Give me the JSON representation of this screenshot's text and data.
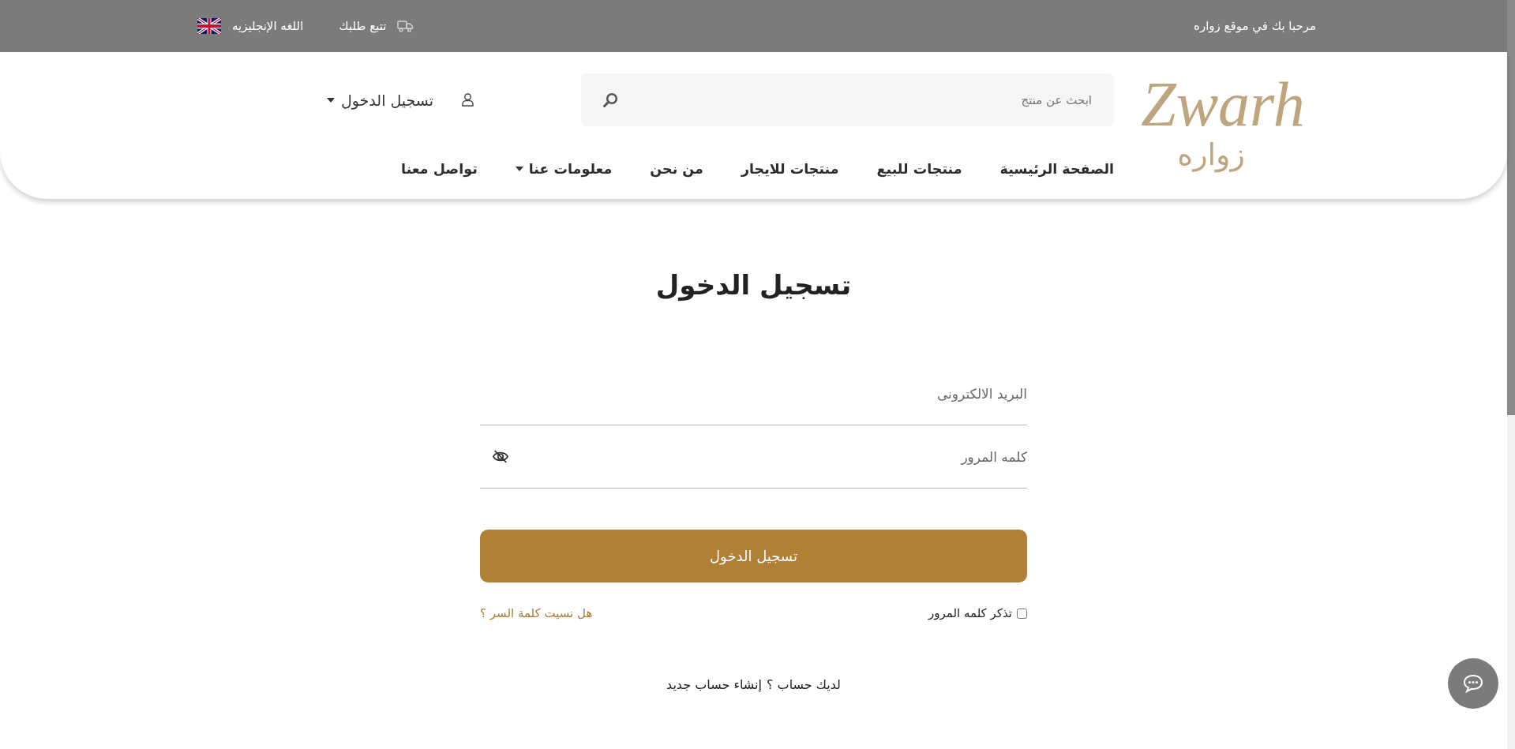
{
  "top_bar": {
    "welcome": "مرحبا بك في موقع زواره",
    "track_order": "تتبع طلبك",
    "language": "اللغه الإنجليزيه"
  },
  "header": {
    "logo": {
      "latin": "Zwarh",
      "arabic": "زواره"
    },
    "search": {
      "placeholder": "ابحث عن منتج"
    },
    "account": {
      "label": "تسجيل الدخول"
    }
  },
  "nav": {
    "items": [
      {
        "label": "الصفحة الرئيسية",
        "kind": "link"
      },
      {
        "label": "منتجات للبيع",
        "kind": "link"
      },
      {
        "label": "منتجات للايجار",
        "kind": "link"
      },
      {
        "label": "من نحن",
        "kind": "link"
      },
      {
        "label": "معلومات عنا",
        "kind": "dropdown"
      },
      {
        "label": "تواصل معنا",
        "kind": "link"
      }
    ]
  },
  "login_form": {
    "title": "تسجيل الدخول",
    "email": {
      "placeholder": "البريد الالكترونى"
    },
    "password": {
      "placeholder": "كلمه المرور"
    },
    "submit": "تسجيل الدخول",
    "remember": {
      "label": "تذكر كلمه المرور",
      "checked": false
    },
    "forgot_link": "هل نسيت كلمة السر ؟",
    "signup_prompt": "لديك حساب ؟",
    "signup_link": "إنشاء حساب جديد"
  }
}
